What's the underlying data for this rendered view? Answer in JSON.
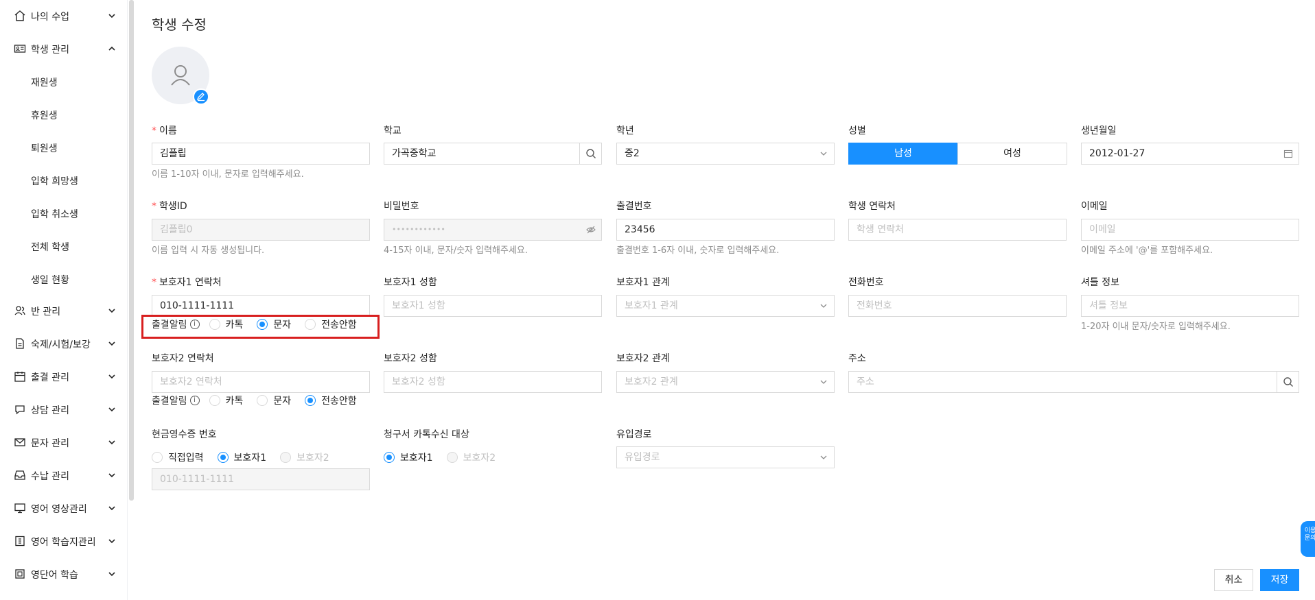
{
  "sidebar": {
    "items": [
      {
        "label": "나의 수업",
        "icon": "home-icon"
      },
      {
        "label": "학생 관리",
        "icon": "id-card-icon",
        "expanded": true,
        "subitems": [
          "재원생",
          "휴원생",
          "퇴원생",
          "입학 희망생",
          "입학 취소생",
          "전체 학생",
          "생일 현황"
        ]
      },
      {
        "label": "반 관리",
        "icon": "users-icon"
      },
      {
        "label": "숙제/시험/보강",
        "icon": "document-icon"
      },
      {
        "label": "출결 관리",
        "icon": "calendar-icon"
      },
      {
        "label": "상담 관리",
        "icon": "chat-icon"
      },
      {
        "label": "문자 관리",
        "icon": "mail-icon"
      },
      {
        "label": "수납 관리",
        "icon": "inbox-icon"
      },
      {
        "label": "영어 영상관리",
        "icon": "monitor-icon"
      },
      {
        "label": "영어 학습지관리",
        "icon": "book-icon"
      },
      {
        "label": "영단어 학습",
        "icon": "dictionary-icon"
      }
    ]
  },
  "page": {
    "title": "학생 수정"
  },
  "form": {
    "name": {
      "label": "이름",
      "value": "김플립",
      "hint": "이름 1-10자 이내, 문자로 입력해주세요."
    },
    "school": {
      "label": "학교",
      "value": "가곡중학교"
    },
    "grade": {
      "label": "학년",
      "value": "중2"
    },
    "gender": {
      "label": "성별",
      "options": [
        "남성",
        "여성"
      ],
      "selected": "남성"
    },
    "birth": {
      "label": "생년월일",
      "value": "2012-01-27"
    },
    "student_id": {
      "label": "학생ID",
      "value": "김플립0",
      "hint": "이름 입력 시 자동 생성됩니다."
    },
    "password": {
      "label": "비밀번호",
      "value": "••••••••••••",
      "hint": "4-15자 이내, 문자/숫자 입력해주세요."
    },
    "attendance_no": {
      "label": "출결번호",
      "value": "23456",
      "hint": "출결번호 1-6자 이내, 숫자로 입력해주세요."
    },
    "student_phone": {
      "label": "학생 연락처",
      "placeholder": "학생 연락처"
    },
    "email": {
      "label": "이메일",
      "placeholder": "이메일",
      "hint": "이메일 주소에 '@'를 포함해주세요."
    },
    "guardian1_phone": {
      "label": "보호자1 연락처",
      "value": "010-1111-1111"
    },
    "guardian1_name": {
      "label": "보호자1 성함",
      "placeholder": "보호자1 성함"
    },
    "guardian1_relation": {
      "label": "보호자1 관계",
      "placeholder": "보호자1 관계"
    },
    "phone": {
      "label": "전화번호",
      "placeholder": "전화번호"
    },
    "shuttle": {
      "label": "셔틀 정보",
      "placeholder": "셔틀 정보",
      "hint": "1-20자 이내 문자/숫자로 입력해주세요."
    },
    "guardian2_phone": {
      "label": "보호자2 연락처",
      "placeholder": "보호자2 연락처"
    },
    "guardian2_name": {
      "label": "보호자2 성함",
      "placeholder": "보호자2 성함"
    },
    "guardian2_relation": {
      "label": "보호자2 관계",
      "placeholder": "보호자2 관계"
    },
    "address": {
      "label": "주소",
      "placeholder": "주소"
    },
    "attendance_alert": {
      "label": "출결알림",
      "options": [
        "카톡",
        "문자",
        "전송안함"
      ],
      "guardian1_selected": "문자",
      "guardian2_selected": "전송안함"
    },
    "cash_receipt": {
      "label": "현금영수증 번호",
      "options": [
        "직접입력",
        "보호자1",
        "보호자2"
      ],
      "selected": "보호자1",
      "value": "010-1111-1111"
    },
    "invoice_target": {
      "label": "청구서 카톡수신 대상",
      "options": [
        "보호자1",
        "보호자2"
      ],
      "selected": "보호자1"
    },
    "inflow": {
      "label": "유입경로",
      "placeholder": "유입경로"
    }
  },
  "actions": {
    "cancel": "취소",
    "save": "저장"
  },
  "float_tab": {
    "label": "이용\n문의"
  },
  "colors": {
    "primary": "#1890ff",
    "required": "#ff4d4f",
    "highlight": "#d81f1f"
  }
}
